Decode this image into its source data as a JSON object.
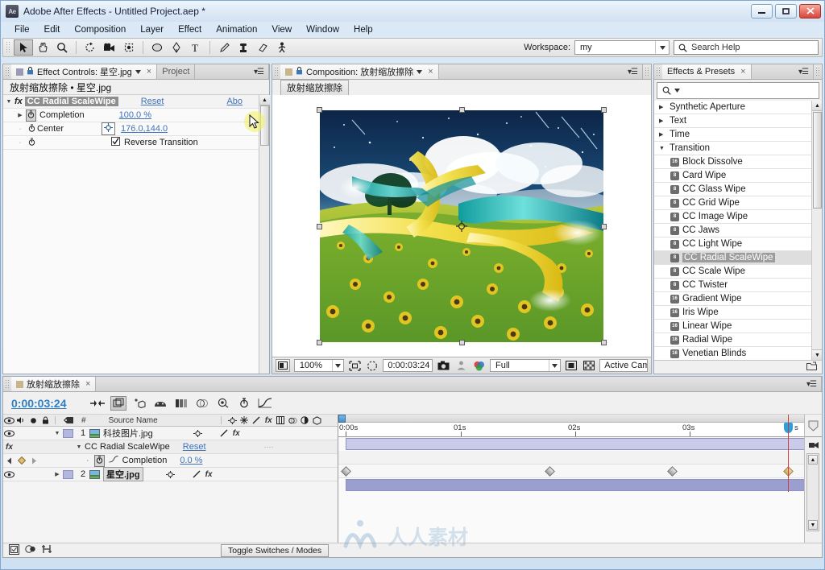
{
  "window": {
    "title": "Adobe After Effects - Untitled Project.aep *",
    "logo_text": "Ae",
    "controls": {
      "minimize": "minimize-button",
      "maximize": "maximize-button",
      "close": "close-button"
    }
  },
  "menubar": {
    "items": [
      "File",
      "Edit",
      "Composition",
      "Layer",
      "Effect",
      "Animation",
      "View",
      "Window",
      "Help"
    ]
  },
  "toolbar": {
    "workspace_label": "Workspace:",
    "workspace_value": "my",
    "search_help_placeholder": "Search Help",
    "tools": [
      "selection-tool",
      "hand-tool",
      "zoom-tool",
      "rotation-tool",
      "camera-tool",
      "pan-behind-tool",
      "shape-tool",
      "pen-tool",
      "text-tool",
      "brush-tool",
      "clone-stamp-tool",
      "eraser-tool",
      "puppet-tool"
    ]
  },
  "effect_controls": {
    "tab_label": "Effect Controls: 星空.jpg",
    "project_tab_label": "Project",
    "subtitle": "放射缩放擦除 • 星空.jpg",
    "effect_name": "CC Radial ScaleWipe",
    "reset_label": "Reset",
    "about_label": "Abo",
    "properties": [
      {
        "name": "Completion",
        "value": "100.0 %"
      },
      {
        "name": "Center",
        "value": "176.0,144.0"
      },
      {
        "name": "",
        "value": "Reverse Transition",
        "checked": true
      }
    ]
  },
  "composition": {
    "tab_label": "Composition: 放射缩放擦除",
    "breadcrumb": "放射缩放擦除",
    "toolbar": {
      "magnification": "100%",
      "current_time": "0:00:03:24",
      "resolution": "Full",
      "view_mode": "Active Came",
      "buttons": [
        "toggle-transparency-grid-icon",
        "region-of-interest-icon",
        "snapshot-icon",
        "show-channel-icon",
        "show-snapshot-icon",
        "toggle-mask-icon",
        "transparency-grid-icon"
      ]
    },
    "image_alt": "sunflower field with starry sky and ribbons"
  },
  "effects_presets": {
    "tab_label": "Effects & Presets",
    "search_placeholder": "",
    "rows": [
      {
        "label": "Synthetic Aperture",
        "type": "group",
        "expanded": false
      },
      {
        "label": "Text",
        "type": "group",
        "expanded": false
      },
      {
        "label": "Time",
        "type": "group",
        "expanded": false
      },
      {
        "label": "Transition",
        "type": "group",
        "expanded": true
      },
      {
        "label": "Block Dissolve",
        "type": "item",
        "bits": "16"
      },
      {
        "label": "Card Wipe",
        "type": "item",
        "bits": "8"
      },
      {
        "label": "CC Glass Wipe",
        "type": "item",
        "bits": "8"
      },
      {
        "label": "CC Grid Wipe",
        "type": "item",
        "bits": "8"
      },
      {
        "label": "CC Image Wipe",
        "type": "item",
        "bits": "8"
      },
      {
        "label": "CC Jaws",
        "type": "item",
        "bits": "8"
      },
      {
        "label": "CC Light Wipe",
        "type": "item",
        "bits": "8"
      },
      {
        "label": "CC Radial ScaleWipe",
        "type": "item",
        "bits": "8",
        "selected": true
      },
      {
        "label": "CC Scale Wipe",
        "type": "item",
        "bits": "8"
      },
      {
        "label": "CC Twister",
        "type": "item",
        "bits": "8"
      },
      {
        "label": "Gradient Wipe",
        "type": "item",
        "bits": "16"
      },
      {
        "label": "Iris Wipe",
        "type": "item",
        "bits": "16"
      },
      {
        "label": "Linear Wipe",
        "type": "item",
        "bits": "16"
      },
      {
        "label": "Radial Wipe",
        "type": "item",
        "bits": "16"
      },
      {
        "label": "Venetian Blinds",
        "type": "item",
        "bits": "16"
      }
    ]
  },
  "timeline": {
    "tab_label": "放射缩放擦除",
    "current_time": "0:00:03:24",
    "column_headers": {
      "number": "#",
      "source_name": "Source Name"
    },
    "ruler_labels": [
      "0:00s",
      "01s",
      "02s",
      "03s",
      "s"
    ],
    "rows": [
      {
        "kind": "layer",
        "index": "1",
        "name": "科技图片.jpg",
        "selected": false
      },
      {
        "kind": "effect",
        "name": "CC Radial ScaleWipe",
        "reset": "Reset"
      },
      {
        "kind": "property",
        "name": "Completion",
        "value": "0.0 %"
      },
      {
        "kind": "layer",
        "index": "2",
        "name": "星空.jpg",
        "selected": true
      }
    ],
    "keyframes_seconds": [
      0.0,
      2.0,
      3.0,
      3.8
    ],
    "footer": {
      "toggle_label": "Toggle Switches / Modes"
    }
  },
  "watermark": {
    "text": "人人素材"
  }
}
